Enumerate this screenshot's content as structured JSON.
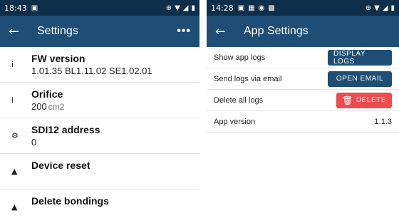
{
  "left": {
    "status_bar": {
      "time": "18:43",
      "right_icons": [
        "signal-icon",
        "wifi-icon",
        "battery-icon"
      ]
    },
    "app_bar": {
      "title": "Settings",
      "more_label": "•••"
    },
    "settings": [
      {
        "label": "FW version",
        "value": "1.01.35 BL1.11.02 SE1.02.01",
        "unit": "",
        "icon": "info-icon"
      },
      {
        "label": "Orifice",
        "value": "200",
        "unit": "cm2",
        "icon": "info-icon"
      },
      {
        "label": "SDI12 address",
        "value": "0",
        "unit": "",
        "icon": "gear-icon"
      },
      {
        "label": "Device reset",
        "value": "",
        "unit": "",
        "icon": "warning-icon"
      },
      {
        "label": "Delete bondings",
        "value": "",
        "unit": "",
        "icon": "warning-icon"
      }
    ]
  },
  "right": {
    "status_bar": {
      "time": "14:28",
      "right_icons": [
        "signal-icon",
        "wifi-icon",
        "battery-icon"
      ]
    },
    "app_bar": {
      "title": "App Settings"
    },
    "rows": [
      {
        "label": "Show app logs",
        "button": "DISPLAY LOGS"
      },
      {
        "label": "Send logs via email",
        "button": "OPEN EMAIL"
      },
      {
        "label": "Delete all logs",
        "button": "DELETE"
      },
      {
        "label": "App version",
        "value": "1.1.3"
      }
    ],
    "colors": {
      "primary": "#1e4e75",
      "danger": "#f04b4f"
    }
  }
}
